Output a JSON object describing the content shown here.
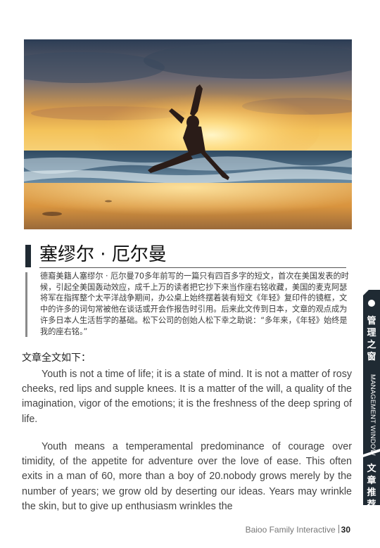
{
  "article": {
    "title": "塞缪尔 · 厄尔曼",
    "intro": "德裔美籍人塞缪尔 · 厄尔曼70多年前写的一篇只有四百多字的短文，首次在美国发表的时候，引起全美国轰动效应，成千上万的读者把它抄下来当作座右铭收藏，美国的麦克阿瑟将军在指挥整个太平洋战争期间，办公桌上始终摆着装有短文《年轻》复印件的镜框，文中的许多的词句常被他在谈话或开会作报告时引用。后来此文传到日本，文章的观点成为许多日本人生活哲学的基础。松下公司的创始人松下幸之助说：“多年来，《年轻》始终是我的座右铭。”",
    "fulltext_label": "文章全文如下：",
    "paragraphs": [
      "Youth is not a time of life; it is a state of mind. It is not a matter of rosy cheeks, red lips and supple knees. It is a matter of the will, a quality of the imagination, vigor of the emotions; it is the freshness of the deep spring of life.",
      "Youth means a temperamental predominance of courage over timidity, of the appetite for adventure over the love of ease. This often exits in a man of 60, more than a boy of 20.nobody grows merely by the number of years; we grow old by deserting our ideas. Years may wrinkle the skin, but to give up enthusiasm wrinkles the"
    ]
  },
  "side_tab": {
    "section_cn": "管理之窗",
    "section_en": "MANAGEMENT WINDOW",
    "column_cn": "文章推荐",
    "color": "#1f2a33"
  },
  "footer": {
    "publication": "Baioo Family Interactive",
    "page_number": "30"
  },
  "photo": {
    "subject": "person-jumping-on-beach-at-sunset"
  }
}
